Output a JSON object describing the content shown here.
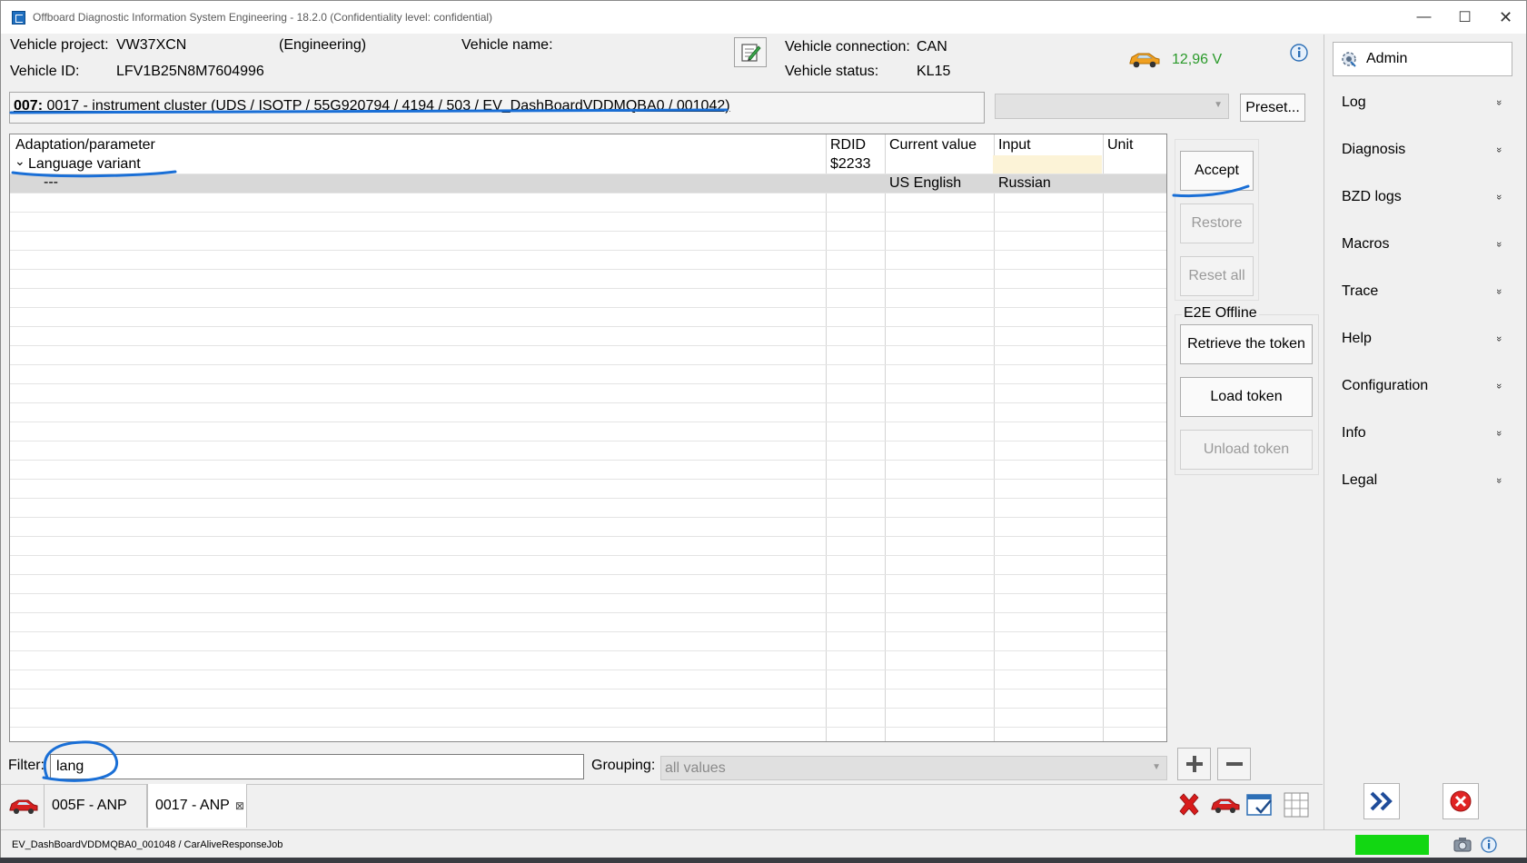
{
  "window": {
    "title": "Offboard Diagnostic Information System Engineering - 18.2.0 (Confidentiality level: confidential)",
    "controls": {
      "minimize": "—",
      "maximize": "☐",
      "close": "✕"
    }
  },
  "header": {
    "vehicle_project_label": "Vehicle project:",
    "vehicle_project_value": "VW37XCN",
    "mode": "(Engineering)",
    "vehicle_name_label": "Vehicle name:",
    "vehicle_id_label": "Vehicle ID:",
    "vehicle_id_value": "LFV1B25N8M7604996",
    "connection_label": "Vehicle connection:",
    "connection_value": "CAN",
    "status_label": "Vehicle status:",
    "status_value": "KL15",
    "voltage": "12,96 V",
    "voltage_color": "#2a9a2a"
  },
  "ecu": {
    "id": "007:",
    "description": " 0017 - instrument cluster  (UDS / ISOTP / 55G920794 / 4194 / 503 / EV_DashBoardVDDMQBA0 / 001042)",
    "preset_combo_value": "",
    "preset_button": "Preset..."
  },
  "grid": {
    "headers": {
      "param": "Adaptation/parameter",
      "rdid": "RDID",
      "current": "Current value",
      "input": "Input",
      "unit": "Unit"
    },
    "group": {
      "label": "Language variant",
      "rdid": "$2233",
      "expander": "⌄"
    },
    "rows": [
      {
        "param": "---",
        "rdid": "",
        "current": "US English",
        "input": "Russian",
        "unit": ""
      }
    ]
  },
  "side_buttons": {
    "accept": "Accept",
    "restore": "Restore",
    "reset_all": "Reset all",
    "e2e_title": "E2E Offline",
    "retrieve": "Retrieve the token",
    "load": "Load token",
    "unload": "Unload token"
  },
  "filter": {
    "label": "Filter:",
    "value": "lang",
    "grouping_label": "Grouping:",
    "grouping_value": "all values"
  },
  "tabs": [
    {
      "label": "005F - ANP",
      "active": false
    },
    {
      "label": "0017 - ANP",
      "active": true,
      "close": "⊠"
    }
  ],
  "right_panel": {
    "admin": "Admin",
    "menu": [
      "Log",
      "Diagnosis",
      "BZD logs",
      "Macros",
      "Trace",
      "Help",
      "Configuration",
      "Info",
      "Legal"
    ],
    "chevron": "»"
  },
  "status": {
    "text": "EV_DashBoardVDDMQBA0_001048 / CarAliveResponseJob",
    "led_color": "#12d712"
  },
  "colors": {
    "annotation": "#1a6fd6",
    "accent_red": "#d81b1b",
    "accent_blue": "#1f6fc0"
  }
}
